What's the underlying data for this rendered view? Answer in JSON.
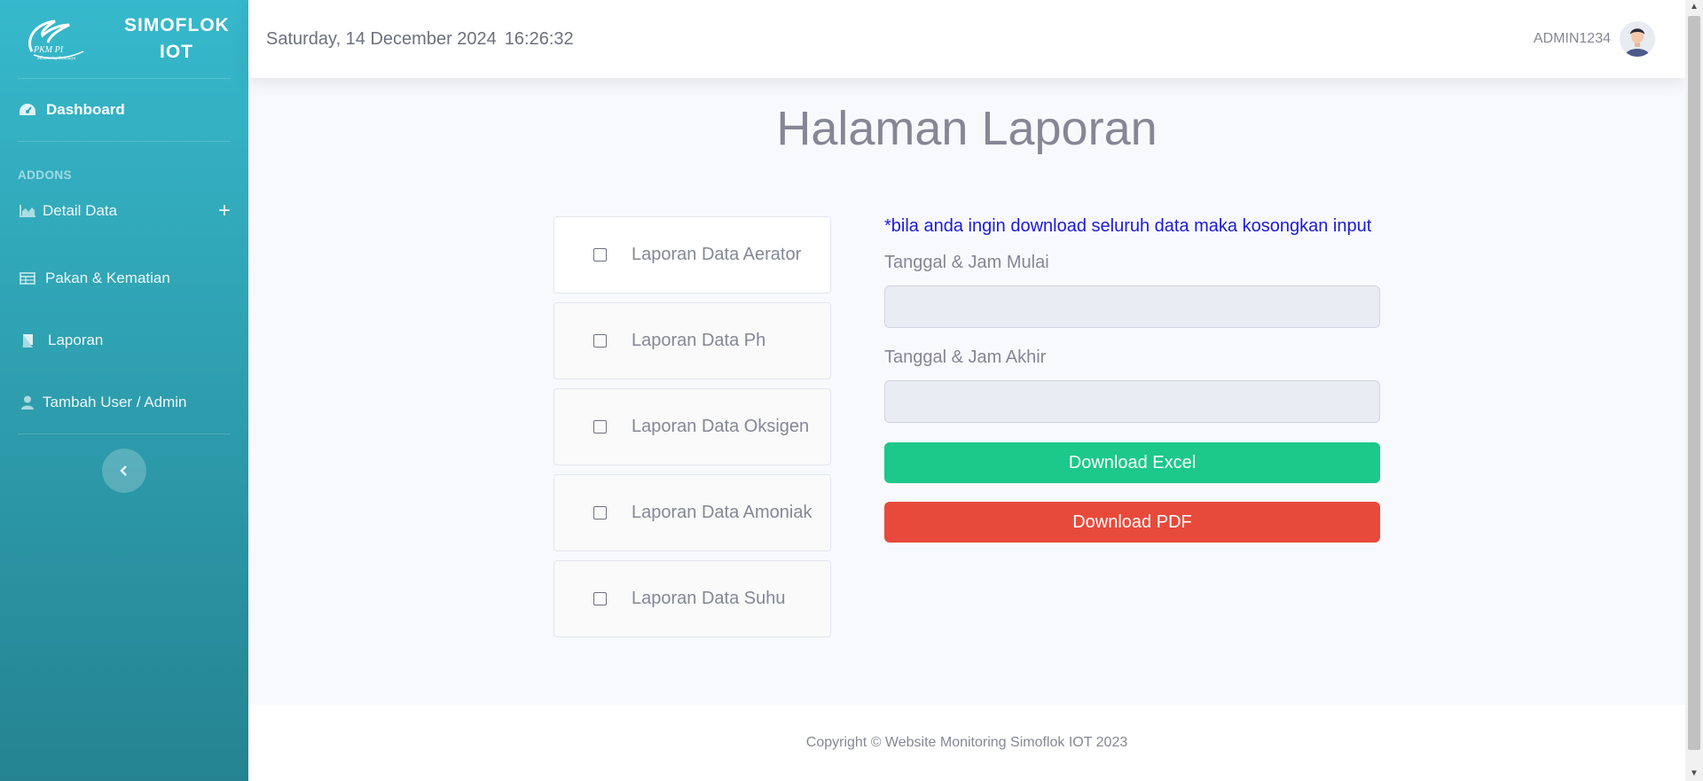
{
  "brand": {
    "name": "SIMOFLOK IOT",
    "line1": "SIMOFLOK",
    "line2": "IOT",
    "logo_text": "PKM PI",
    "logo_subtext": "Monitoring Budidaya"
  },
  "sidebar": {
    "dashboard": "Dashboard",
    "addons_heading": "ADDONS",
    "items": [
      {
        "label": "Detail Data",
        "icon": "chart-area-icon",
        "expandable": true
      },
      {
        "label": "Pakan & Kematian",
        "icon": "table-icon"
      },
      {
        "label": "Laporan",
        "icon": "book-icon"
      },
      {
        "label": "Tambah User / Admin",
        "icon": "user-icon"
      }
    ],
    "toggle_icon": "chevron-left-icon"
  },
  "topbar": {
    "date": "Saturday, 14 December 2024",
    "time": "16:26:32",
    "username": "ADMIN1234"
  },
  "page": {
    "title": "Halaman Laporan"
  },
  "reports": [
    {
      "label": "Laporan Data Aerator",
      "checked": false
    },
    {
      "label": "Laporan Data Ph",
      "checked": false
    },
    {
      "label": "Laporan Data Oksigen",
      "checked": false
    },
    {
      "label": "Laporan Data Amoniak",
      "checked": false
    },
    {
      "label": "Laporan Data Suhu",
      "checked": false
    }
  ],
  "form": {
    "note": "*bila anda ingin download seluruh data maka kosongkan input",
    "start_label": "Tanggal & Jam Mulai",
    "start_value": "",
    "end_label": "Tanggal & Jam Akhir",
    "end_value": "",
    "excel_button": "Download Excel",
    "pdf_button": "Download PDF"
  },
  "footer": {
    "copyright": "Copyright © Website Monitoring Simoflok IOT 2023"
  },
  "colors": {
    "sidebar_top": "#36b9cc",
    "sidebar_bottom": "#258391",
    "excel": "#1cc88a",
    "pdf": "#e74a3b",
    "note": "#1c1ad6"
  }
}
